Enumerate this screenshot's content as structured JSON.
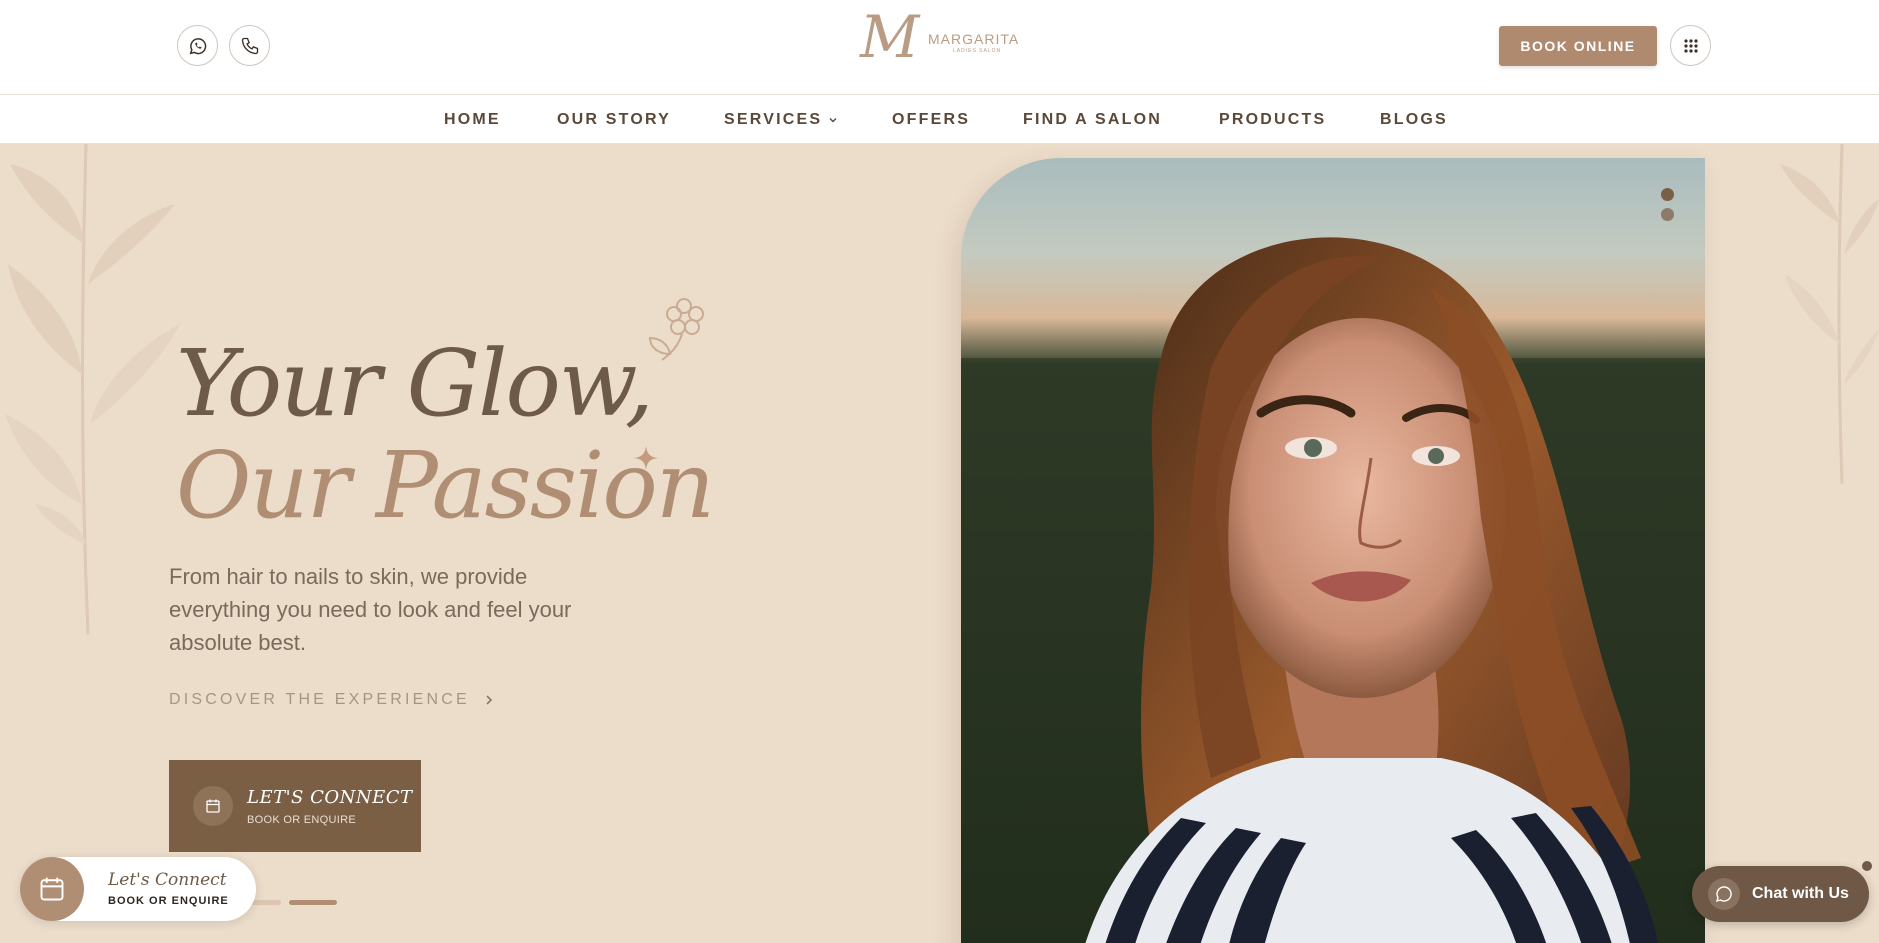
{
  "header": {
    "whatsapp_icon": "whatsapp-icon",
    "phone_icon": "phone-icon",
    "logo": {
      "monogram": "M",
      "brand": "MARGARITA",
      "sub": "LADIES SALON"
    },
    "book_online_label": "BOOK ONLINE",
    "apps_icon": "grid-icon"
  },
  "nav": {
    "items": [
      {
        "label": "HOME"
      },
      {
        "label": "OUR STORY"
      },
      {
        "label": "SERVICES"
      },
      {
        "label": "OFFERS"
      },
      {
        "label": "FIND A SALON"
      },
      {
        "label": "PRODUCTS"
      },
      {
        "label": "BLOGS"
      }
    ]
  },
  "hero": {
    "headline_line1": "Your Glow,",
    "headline_line2": "Our Passion",
    "lead": "From hair to nails to skin, we provide everything you need to look and feel your absolute best.",
    "discover_label": "DISCOVER THE EXPERIENCE",
    "connect_title": "LET'S CONNECT",
    "connect_sub": "BOOK OR ENQUIRE",
    "slide_count": 2,
    "active_slide": 2
  },
  "float_connect": {
    "title": "Let's Connect",
    "sub": "BOOK OR ENQUIRE"
  },
  "chat": {
    "label": "Chat with Us"
  },
  "colors": {
    "brand": "#b08a6e",
    "dark_brown": "#7a5f45",
    "hero_bg": "#ecdcca",
    "text_dark": "#5a4838"
  }
}
